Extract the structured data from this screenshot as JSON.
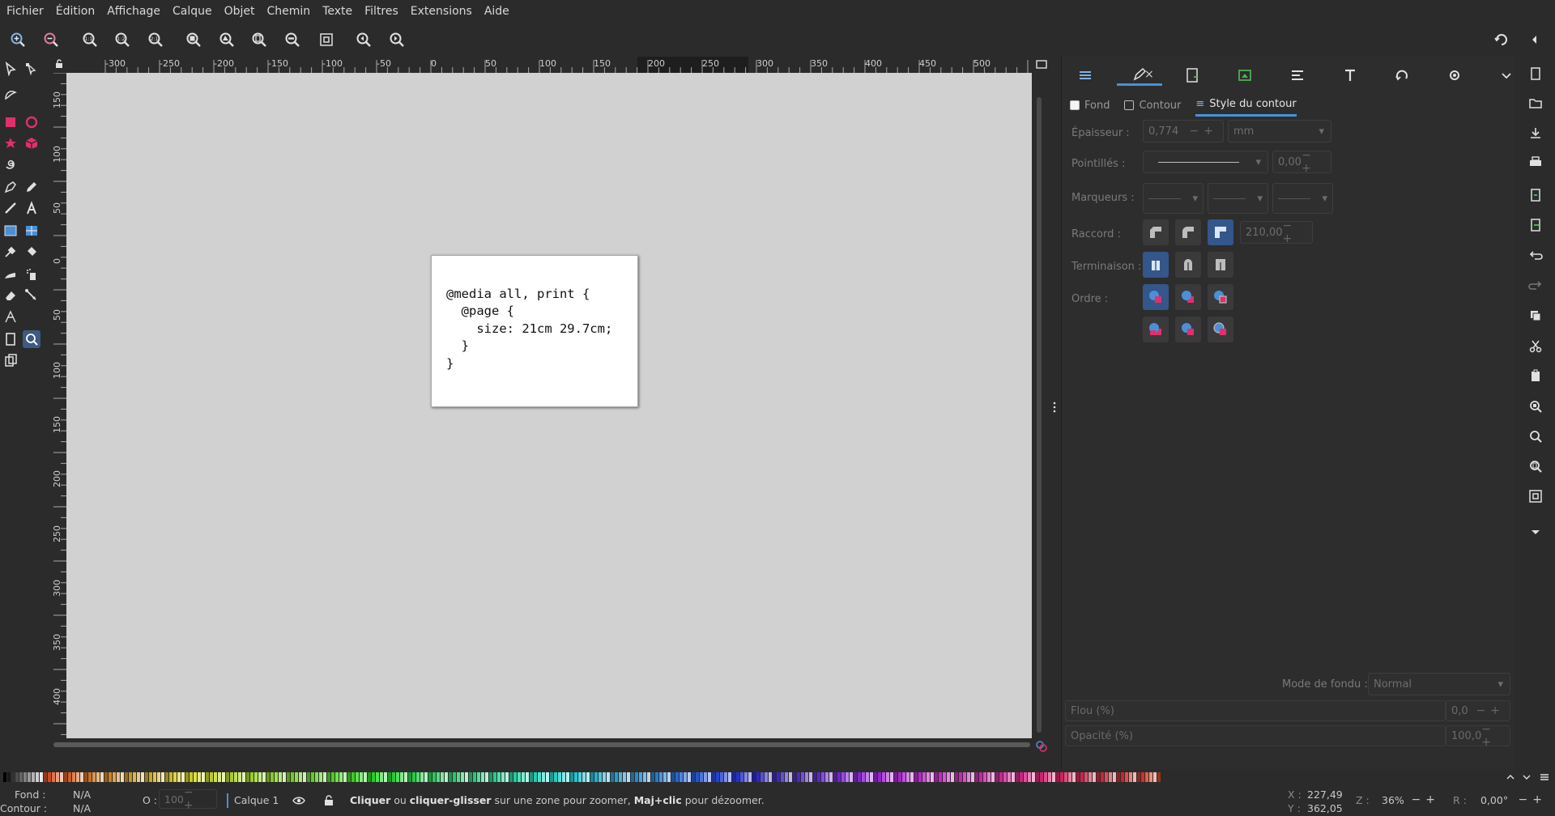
{
  "menu": [
    "Fichier",
    "Édition",
    "Affichage",
    "Calque",
    "Objet",
    "Chemin",
    "Texte",
    "Filtres",
    "Extensions",
    "Aide"
  ],
  "ruler": {
    "h": [
      "-300",
      "-250",
      "-200",
      "-150",
      "-100",
      "-50",
      "0",
      "50",
      "100",
      "150",
      "200",
      "250",
      "300",
      "350",
      "400",
      "450",
      "500"
    ],
    "v": [
      "150",
      "100",
      "50",
      "0",
      "50",
      "100",
      "150",
      "200",
      "250",
      "300",
      "350",
      "400"
    ]
  },
  "document": {
    "code_lines": [
      "@media all, print {",
      "  @page {",
      "    size: 21cm 29.7cm;",
      "  }",
      "}"
    ]
  },
  "panel": {
    "subtabs": [
      "Fond",
      "Contour",
      "Style du contour"
    ],
    "width_label": "Épaisseur :",
    "width_value": "0,774",
    "unit_value": "mm",
    "dashes_label": "Pointillés :",
    "dash_offset": "0,00",
    "markers_label": "Marqueurs :",
    "join_label": "Raccord :",
    "miter_value": "210,00",
    "cap_label": "Terminaison :",
    "order_label": "Ordre :",
    "blend_label": "Mode de fondu :",
    "blend_value": "Normal",
    "blur_label": "Flou (%)",
    "blur_value": "0,0",
    "opacity_label": "Opacité (%)",
    "opacity_value": "100,0"
  },
  "status": {
    "fill_label": "Fond :",
    "fill_value": "N/A",
    "stroke_label": "Contour :",
    "stroke_value": "N/A",
    "o_label": "O :",
    "o_value": "100",
    "layer": "Calque 1",
    "msg_b1": "Cliquer",
    "msg_1": " ou ",
    "msg_b2": "cliquer-glisser",
    "msg_2": " sur une zone pour zoomer, ",
    "msg_b3": "Maj+clic",
    "msg_3": " pour dézoomer.",
    "x_label": "X :",
    "x_value": "227,49",
    "y_label": "Y :",
    "y_value": "362,05",
    "z_label": "Z :",
    "zoom": "36%",
    "r_label": "R :",
    "rotation": "0,00°"
  },
  "colors": {
    "accent": "#4a90d9",
    "canvas": "#d1d1d1",
    "ui_bg": "#2b2b2b",
    "tool_pink": "#e0306a"
  }
}
